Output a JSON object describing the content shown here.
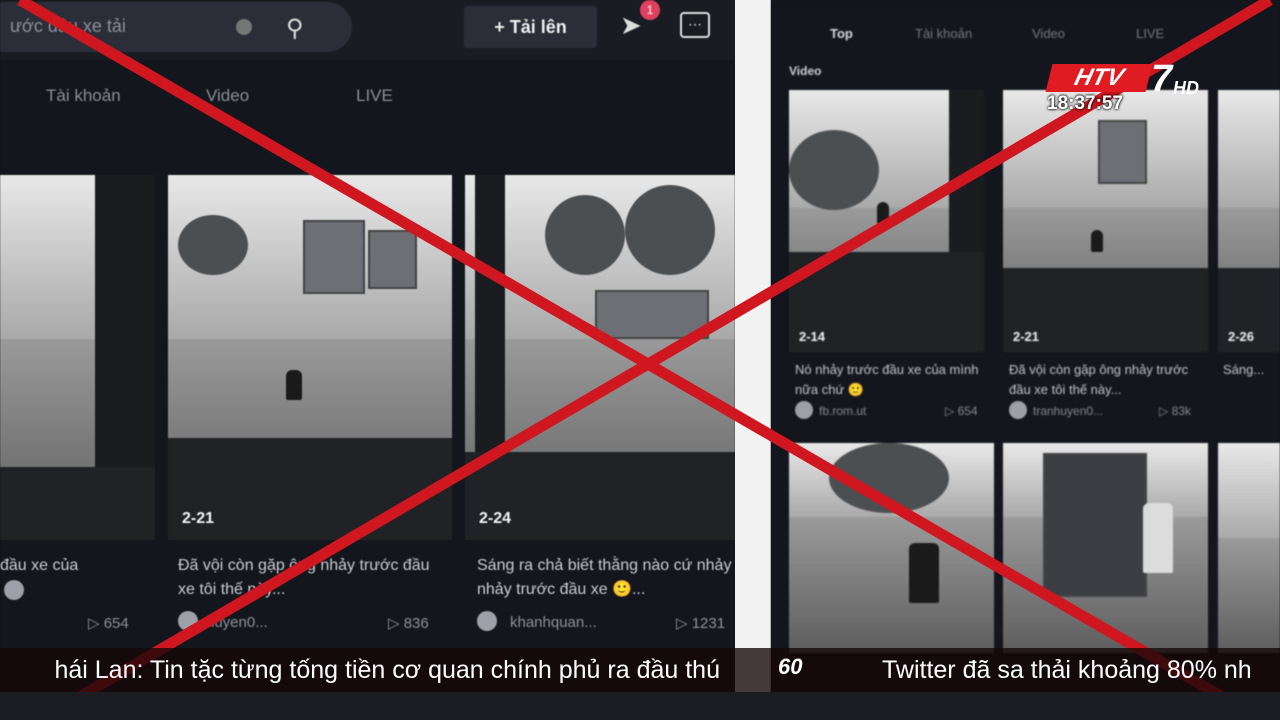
{
  "left": {
    "search_text": "ước đầu xe tải",
    "upload_label": "+ Tải lên",
    "notification_count": "1",
    "tabs": [
      "Tài khoản",
      "Video",
      "LIVE"
    ],
    "cards": [
      {
        "duration": "",
        "caption": "đầu xe của",
        "author": "",
        "views": "654"
      },
      {
        "duration": "2-21",
        "caption": "Đã vội còn gặp ông nhảy trước đầu xe tôi thế này...",
        "author": "huyen0...",
        "views": "836"
      },
      {
        "duration": "2-24",
        "caption": "Sáng ra chả biết thằng nào cứ nhảy nhảy trước đầu xe 🙂...",
        "author": "khanhquan...",
        "views": "1231"
      }
    ]
  },
  "right": {
    "tabs": [
      "Top",
      "Tài khoản",
      "Video",
      "LIVE"
    ],
    "section_label": "Video",
    "cards": [
      {
        "duration": "2-14",
        "caption": "Nó nhảy trước đầu xe của mình nữa chứ 🙂",
        "author": "fb.rom.ut",
        "views": "654"
      },
      {
        "duration": "2-21",
        "caption": "Đã vội còn gặp ông nhảy trước đầu xe tôi thế này...",
        "author": "tranhuyen0...",
        "views": "83k"
      },
      {
        "duration": "2-26",
        "caption": "Sáng...",
        "author": "",
        "views": ""
      }
    ]
  },
  "broadcast": {
    "channel_letters": "HTV",
    "channel_number": "7",
    "hd": "HD",
    "time": "18:37:57",
    "ticker_left": "hái Lan: Tin tặc từng tống tiền cơ quan chính phủ ra đầu thú",
    "ticker_logo": "60",
    "ticker_right": "Twitter đã sa thải khoảng 80% nh"
  },
  "colors": {
    "cross": "#d0161e",
    "logo_red": "#e11b22"
  }
}
